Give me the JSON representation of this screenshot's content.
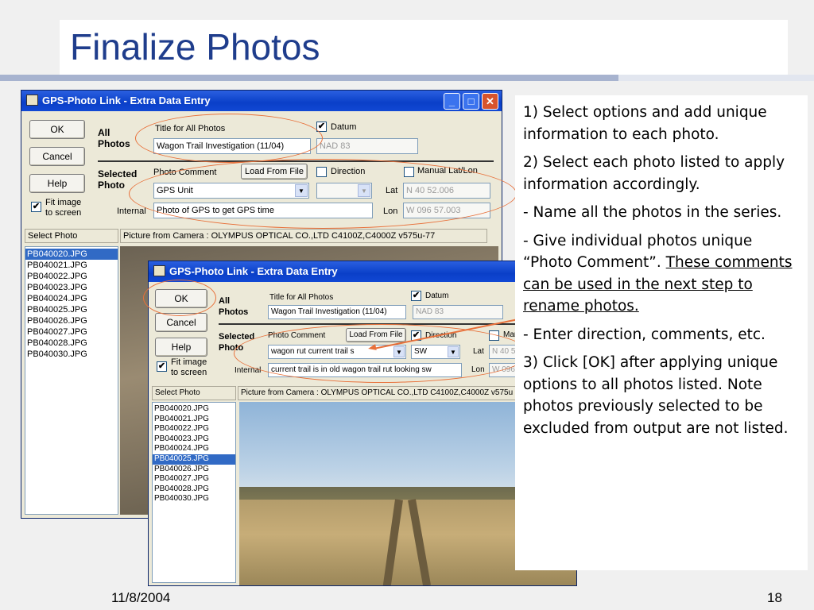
{
  "slide": {
    "title": "Finalize Photos",
    "date": "11/8/2004",
    "page": "18"
  },
  "notes": {
    "p1": "1) Select options and add unique information to each photo.",
    "p2": "2) Select each photo listed to apply information accordingly.",
    "p3": " - Name all the photos in the series.",
    "p4a": "- Give individual photos unique “Photo Comment”.",
    "p4b": "These comments can be used in the next step to rename photos.",
    "p5": "- Enter direction, comments, etc.",
    "p6": "3) Click [OK] after applying unique options to all photos listed.  Note photos previously selected to be excluded from output are not listed."
  },
  "win1": {
    "title": "GPS-Photo Link  - Extra Data Entry",
    "ok": "OK",
    "cancel": "Cancel",
    "help": "Help",
    "fit_image": "Fit image to screen",
    "fit_checked": "✔",
    "all_photos": "All Photos",
    "title_all_label": "Title for All Photos",
    "title_all_value": "Wagon Trail Investigation (11/04)",
    "datum_label": "Datum",
    "datum_checked": "✔",
    "datum_value": "NAD 83",
    "selected_photo": "Selected Photo",
    "photo_comment_label": "Photo Comment",
    "load_from_file": "Load From File",
    "direction_label": "Direction",
    "manual_latlon": "Manual Lat/Lon",
    "comment_value": "GPS Unit",
    "lat_label": "Lat",
    "lat_value": "N 40 52.006",
    "internal_label": "Internal",
    "internal_value": "Photo of GPS to get GPS time",
    "lon_label": "Lon",
    "lon_value": "W 096 57.003",
    "select_photo_header": "Select Photo",
    "picture_header": "Picture from Camera : OLYMPUS OPTICAL CO.,LTD C4100Z,C4000Z v575u-77",
    "files": [
      "PB040020.JPG",
      "PB040021.JPG",
      "PB040022.JPG",
      "PB040023.JPG",
      "PB040024.JPG",
      "PB040025.JPG",
      "PB040026.JPG",
      "PB040027.JPG",
      "PB040028.JPG",
      "PB040030.JPG"
    ],
    "selected_index": 0
  },
  "win2": {
    "title": "GPS-Photo Link  - Extra Data Entry",
    "ok": "OK",
    "cancel": "Cancel",
    "help": "Help",
    "fit_image": "Fit image to screen",
    "fit_checked": "✔",
    "all_photos": "All Photos",
    "title_all_label": "Title for All Photos",
    "title_all_value": "Wagon Trail Investigation (11/04)",
    "datum_label": "Datum",
    "datum_checked": "✔",
    "datum_value": "NAD 83",
    "selected_photo": "Selected Photo",
    "photo_comment_label": "Photo Comment",
    "load_from_file": "Load From File",
    "direction_label": "Direction",
    "direction_checked": "✔",
    "manual_label": "Man",
    "comment_value": "wagon rut current trail s",
    "direction_value": "SW",
    "lat_label": "Lat",
    "lat_value": "N 40 5",
    "internal_label": "Internal",
    "internal_value": "current trail is in old wagon trail rut looking sw",
    "lon_label": "Lon",
    "lon_value": "W 096",
    "select_photo_header": "Select Photo",
    "picture_header": "Picture from Camera : OLYMPUS OPTICAL CO.,LTD C4100Z,C4000Z v575u",
    "files": [
      "PB040020.JPG",
      "PB040021.JPG",
      "PB040022.JPG",
      "PB040023.JPG",
      "PB040024.JPG",
      "PB040025.JPG",
      "PB040026.JPG",
      "PB040027.JPG",
      "PB040028.JPG",
      "PB040030.JPG"
    ],
    "selected_index": 5
  },
  "colors": {
    "title": "#1f3d8c",
    "annotation": "#e8703a",
    "selection": "#316ac5"
  }
}
